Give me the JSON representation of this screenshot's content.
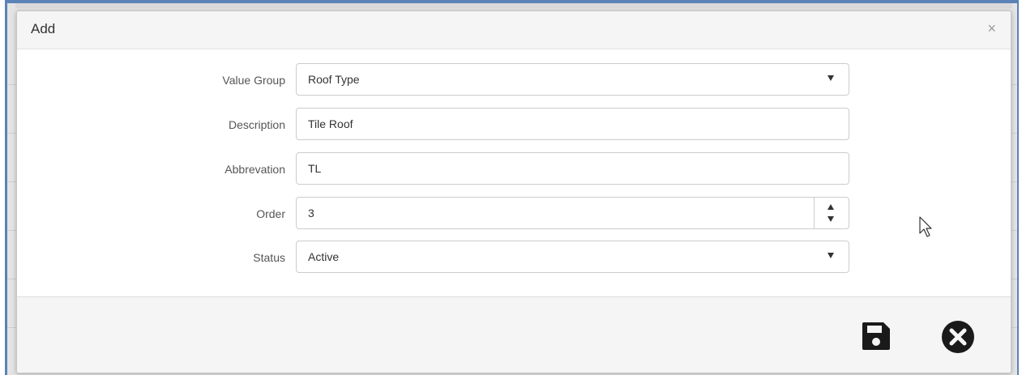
{
  "modal": {
    "title": "Add",
    "close_glyph": "×"
  },
  "form": {
    "value_group": {
      "label": "Value Group",
      "value": "Roof Type"
    },
    "description": {
      "label": "Description",
      "value": "Tile Roof"
    },
    "abbreviation": {
      "label": "Abbrevation",
      "value": "TL"
    },
    "order": {
      "label": "Order",
      "value": "3"
    },
    "status": {
      "label": "Status",
      "value": "Active"
    }
  },
  "footer": {
    "save_icon": "floppy-disk-icon",
    "cancel_icon": "circle-x-icon"
  },
  "colors": {
    "frame": "#5b83b8",
    "header_bg": "#f5f5f5",
    "icon": "#1a1a1a"
  }
}
